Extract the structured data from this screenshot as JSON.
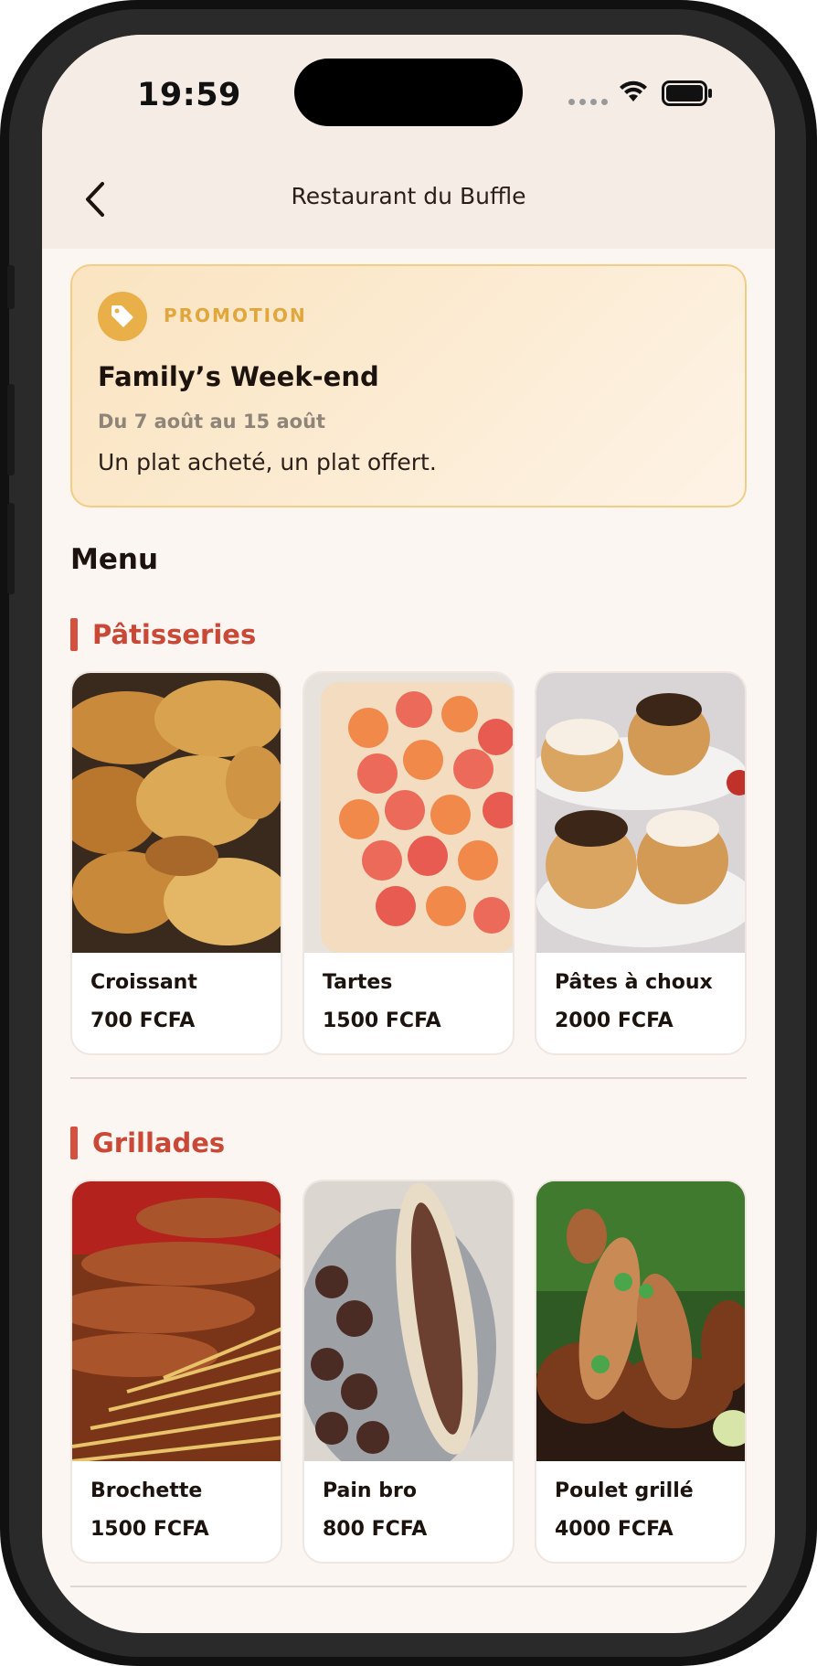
{
  "status": {
    "time": "19:59"
  },
  "nav": {
    "title": "Restaurant du Buffle"
  },
  "promo": {
    "label": "PROMOTION",
    "title": "Family’s Week-end",
    "dates": "Du 7 août au 15 août",
    "description": "Un plat acheté, un plat offert."
  },
  "menu": {
    "title": "Menu",
    "sections": [
      {
        "title": "Pâtisseries",
        "items": [
          {
            "name": "Croissant",
            "price": "700 FCFA"
          },
          {
            "name": "Tartes",
            "price": "1500 FCFA"
          },
          {
            "name": "Pâtes à choux",
            "price": "2000 FCFA"
          }
        ]
      },
      {
        "title": "Grillades",
        "items": [
          {
            "name": "Brochette",
            "price": "1500 FCFA"
          },
          {
            "name": "Pain bro",
            "price": "800 FCFA"
          },
          {
            "name": "Poulet grillé",
            "price": "4000 FCFA"
          }
        ]
      }
    ]
  },
  "colors": {
    "accent_red": "#c94836",
    "promo_gold": "#e9b04a",
    "background": "#fcf6f3"
  },
  "icons": {
    "back": "chevron-left-icon",
    "promo": "tag-icon"
  }
}
